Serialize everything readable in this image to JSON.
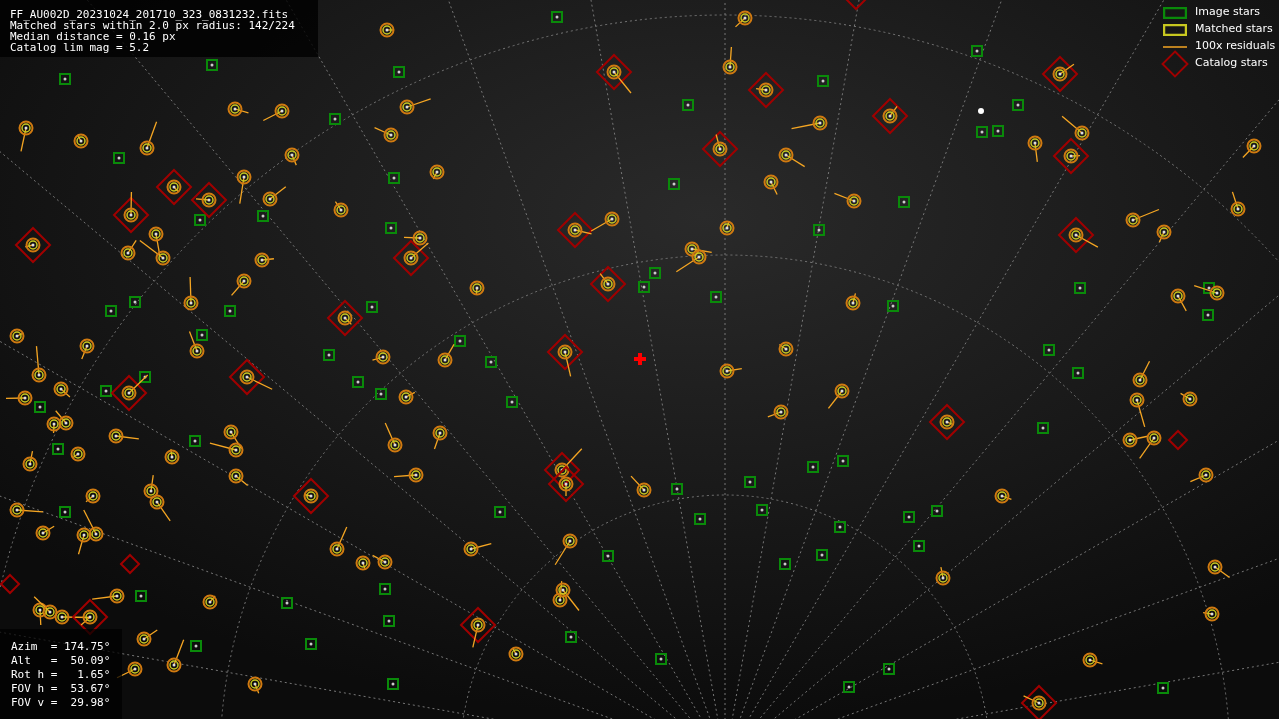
{
  "info": {
    "lines": [
      "FF_AU002D_20231024_201710_323_0831232.fits",
      "Matched stars within 2.0 px radius: 142/224",
      "Median distance = 0.16 px",
      "Catalog lim mag = 5.2"
    ]
  },
  "legend": [
    {
      "kind": "image",
      "label": "Image stars"
    },
    {
      "kind": "matched",
      "label": "Matched stars"
    },
    {
      "kind": "residual",
      "label": "100x residuals"
    },
    {
      "kind": "catalog",
      "label": "Catalog stars"
    }
  ],
  "pointing": {
    "lines": [
      "Azim  = 174.75°",
      "Alt   =  50.09°",
      "Rot h =   1.65°",
      "FOV h =  53.67°",
      "FOV v =  29.98°"
    ]
  }
}
